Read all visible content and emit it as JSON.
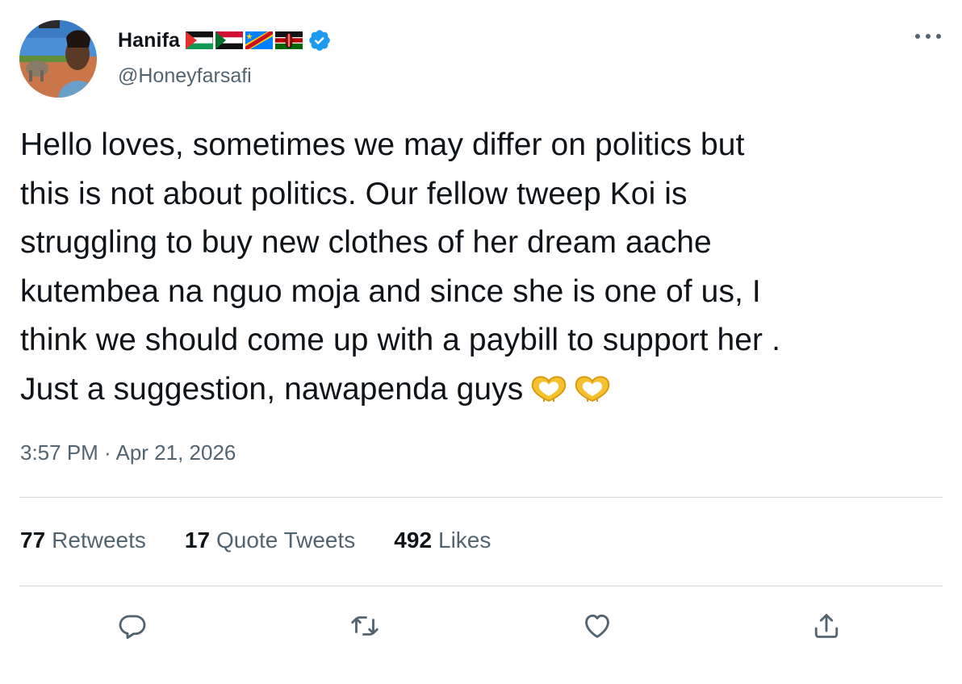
{
  "author": {
    "display_name": "Hanifa",
    "handle": "@Honeyfarsafi",
    "flags": [
      "flag-palestine",
      "flag-sudan",
      "flag-dr-congo",
      "flag-kenya"
    ],
    "verified": true
  },
  "tweet": {
    "text": "Hello loves, sometimes we may differ on politics but\nthis is not about politics. Our fellow tweep Koi is\nstruggling to buy new clothes of her dream aache\nkutembea na nguo moja and since she is one of us, I\nthink we should come up with a paybill to support her .\nJust a suggestion, nawapenda guys",
    "emoji": [
      "heart-hands-emoji",
      "heart-hands-emoji"
    ],
    "timestamp": "3:57 PM · Apr 21, 2026"
  },
  "stats": {
    "retweets_count": "77",
    "retweets_label": "Retweets",
    "quote_tweets_count": "17",
    "quote_tweets_label": "Quote Tweets",
    "likes_count": "492",
    "likes_label": "Likes"
  },
  "actions": [
    "reply-icon",
    "retweet-icon",
    "like-icon",
    "share-icon"
  ],
  "colors": {
    "text": "#0f1419",
    "secondary": "#536471",
    "divider": "#cfd9de",
    "verified": "#1d9bf0"
  }
}
